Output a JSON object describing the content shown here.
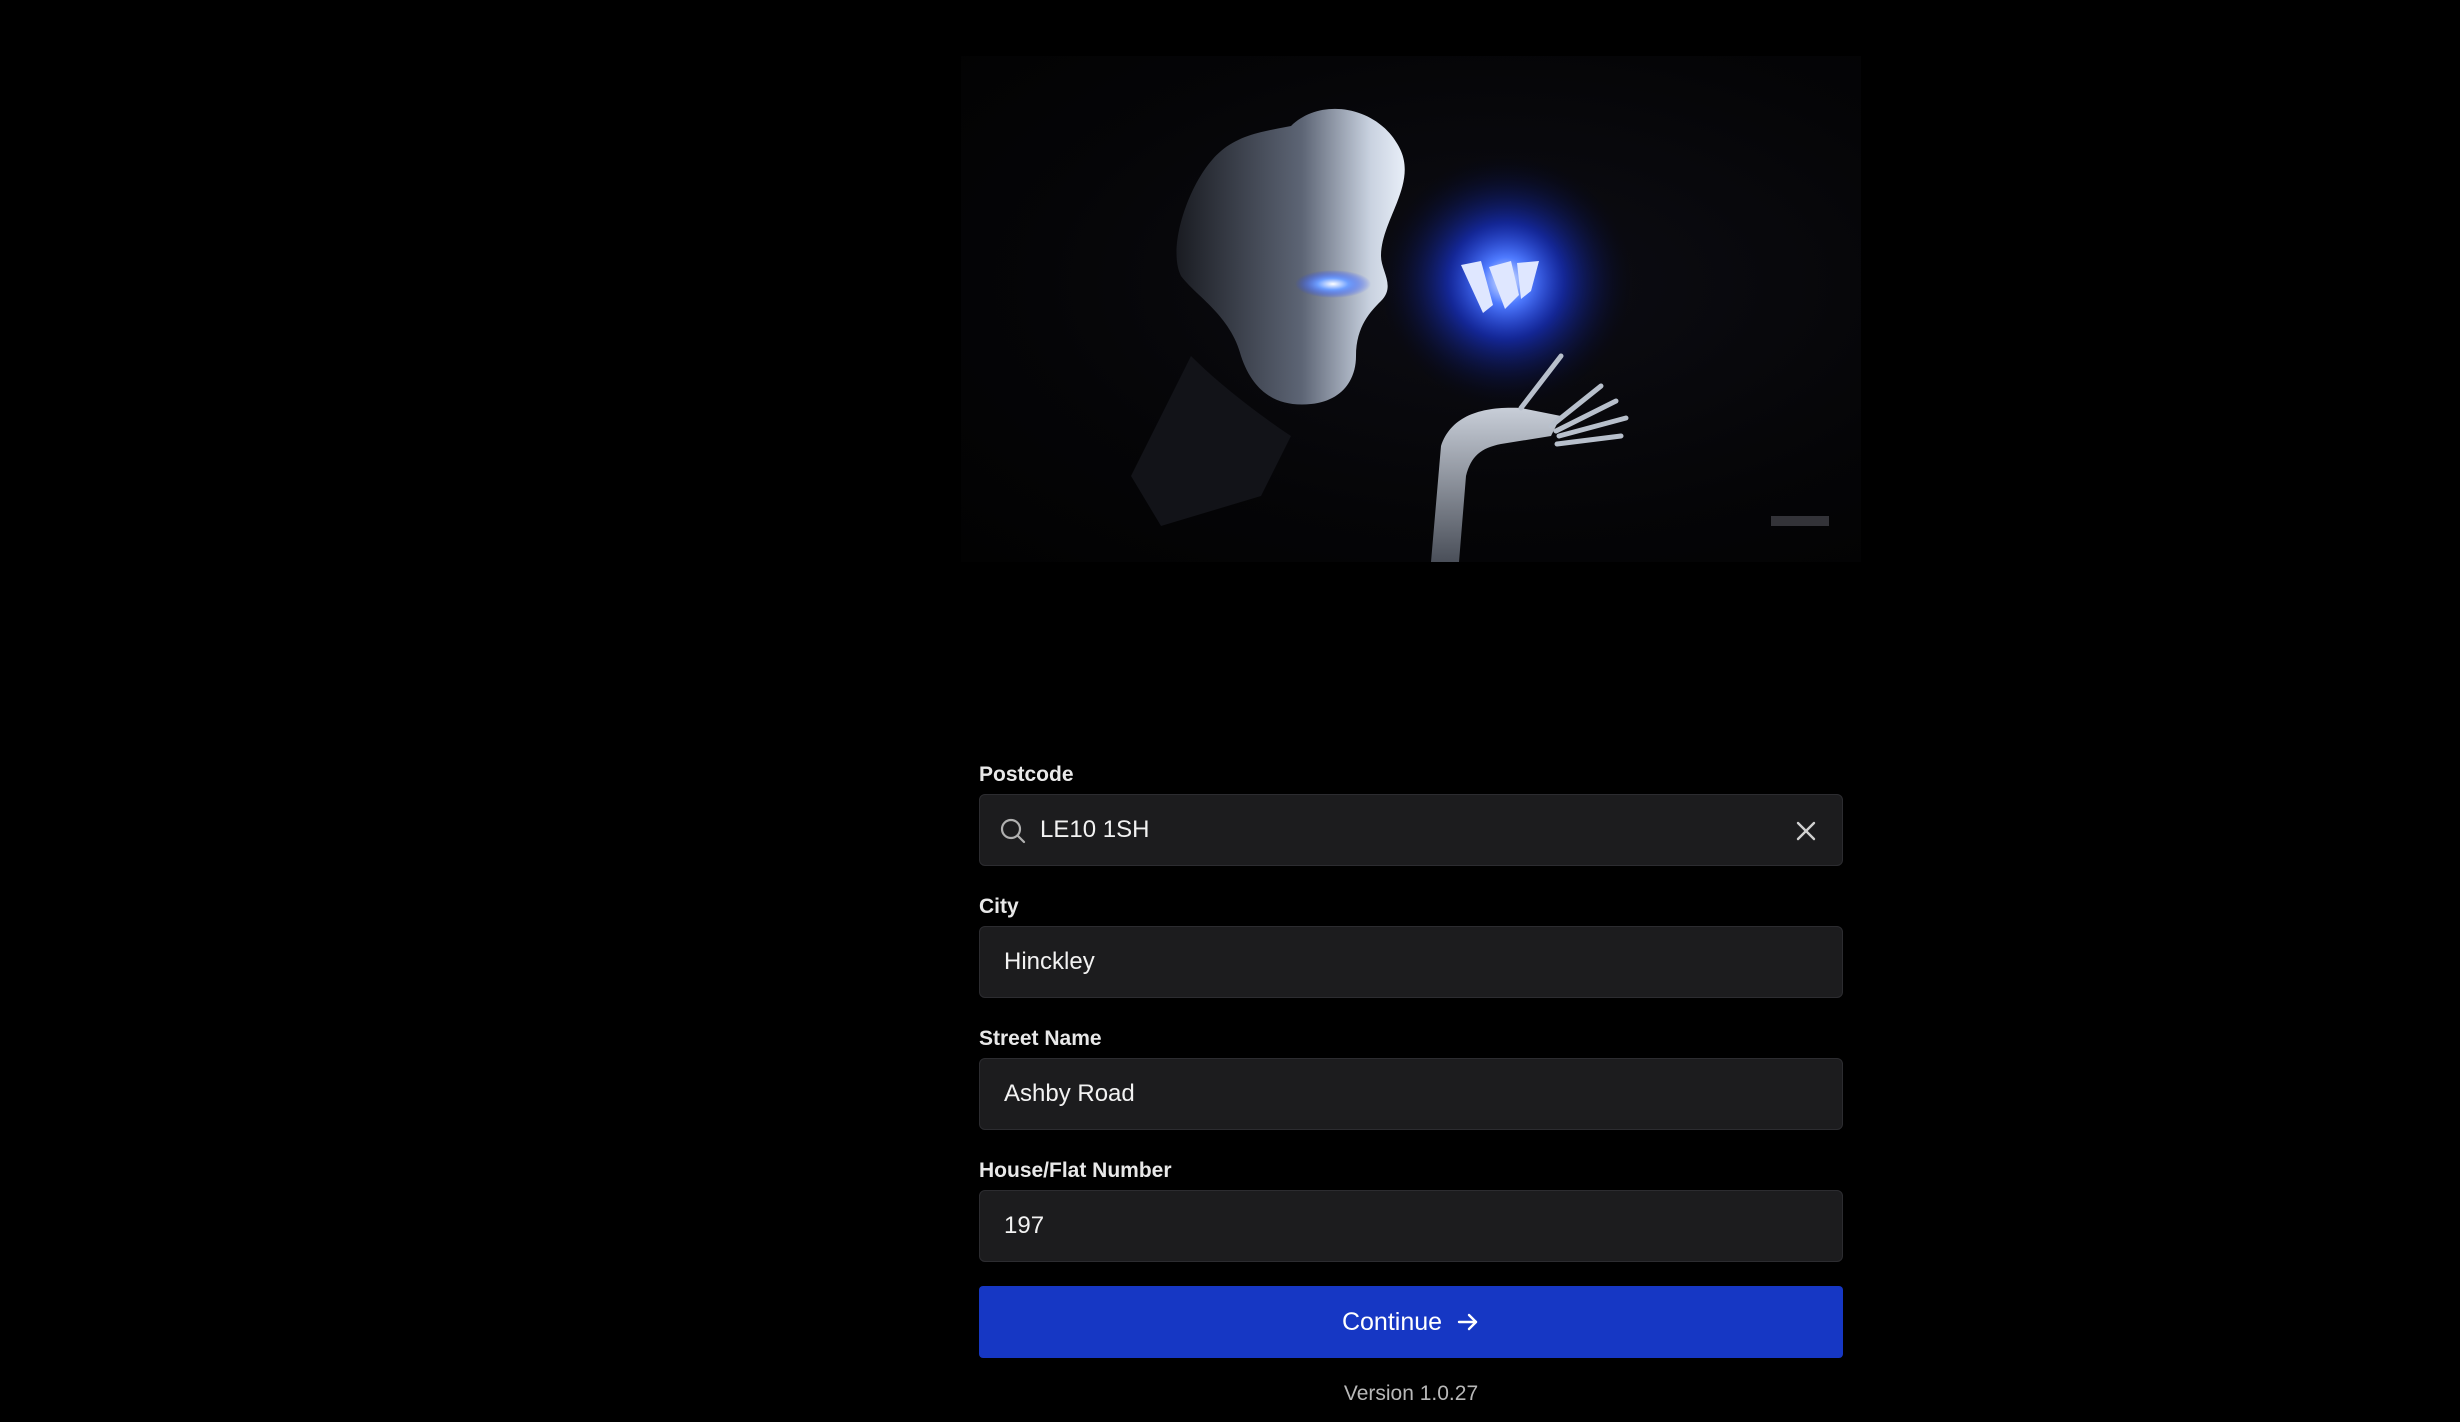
{
  "hero": {
    "image_icon": "robot-with-glowing-orb-illustration"
  },
  "form": {
    "postcode": {
      "label": "Postcode",
      "value": "LE10 1SH",
      "search_icon": "search-icon",
      "clear_icon": "close-icon"
    },
    "city": {
      "label": "City",
      "value": "Hinckley"
    },
    "street": {
      "label": "Street Name",
      "value": "Ashby Road"
    },
    "house": {
      "label": "House/Flat Number",
      "value": "197"
    },
    "continue": {
      "label": "Continue",
      "icon": "arrow-right-icon",
      "color": "#1637c4"
    }
  },
  "footer": {
    "version": "Version 1.0.27"
  }
}
